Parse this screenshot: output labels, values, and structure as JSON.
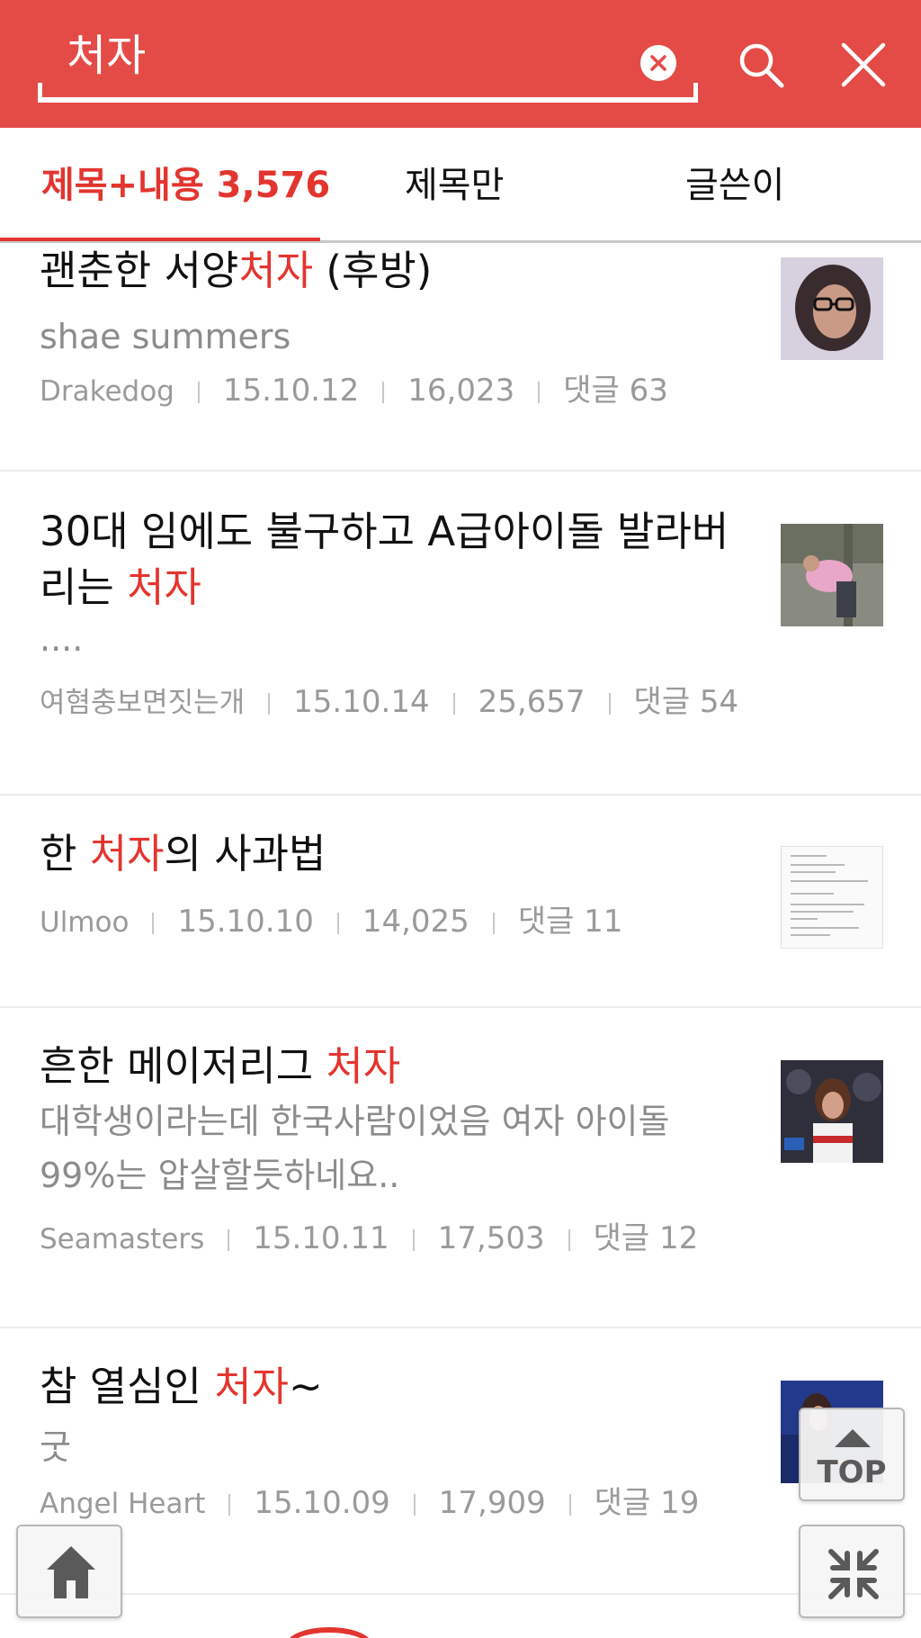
{
  "search": {
    "query": "처자"
  },
  "tabs": [
    {
      "label": "제목+내용 3,576"
    },
    {
      "label": "제목만"
    },
    {
      "label": "글쓴이"
    }
  ],
  "results": [
    {
      "title_before": "괜춘한 서양",
      "title_highlight": "처자",
      "title_after": " (후방)",
      "snippet": "shae summers",
      "author": "Drakedog",
      "date": "15.10.12",
      "views": "16,023",
      "comments": "댓글 63"
    },
    {
      "title_before": "30대 임에도 불구하고 A급아이돌 발라버리는 ",
      "title_highlight": "처자",
      "title_after": "",
      "snippet": "....",
      "author": "여혐충보면짓는개",
      "date": "15.10.14",
      "views": "25,657",
      "comments": "댓글 54"
    },
    {
      "title_before": "한 ",
      "title_highlight": "처자",
      "title_after": "의 사과법",
      "snippet": "",
      "author": "Ulmoo",
      "date": "15.10.10",
      "views": "14,025",
      "comments": "댓글 11"
    },
    {
      "title_before": "흔한 메이저리그 ",
      "title_highlight": "처자",
      "title_after": "",
      "snippet": "대학생이라는데 한국사람이었음 여자 아이돌 99%는 압살할듯하네요..",
      "author": "Seamasters",
      "date": "15.10.11",
      "views": "17,503",
      "comments": "댓글 12"
    },
    {
      "title_before": "참 열심인 ",
      "title_highlight": "처자",
      "title_after": "~",
      "snippet": "굿",
      "author": "Angel Heart",
      "date": "15.10.09",
      "views": "17,909",
      "comments": "댓글 19"
    }
  ],
  "floating": {
    "top_label": "TOP"
  },
  "colors": {
    "header": "#e44b47",
    "accent": "#e3352f",
    "meta": "#9a9a9a"
  },
  "icons": [
    "clear-icon",
    "search-icon",
    "close-icon",
    "arrow-up-icon",
    "home-icon",
    "collapse-icon"
  ]
}
